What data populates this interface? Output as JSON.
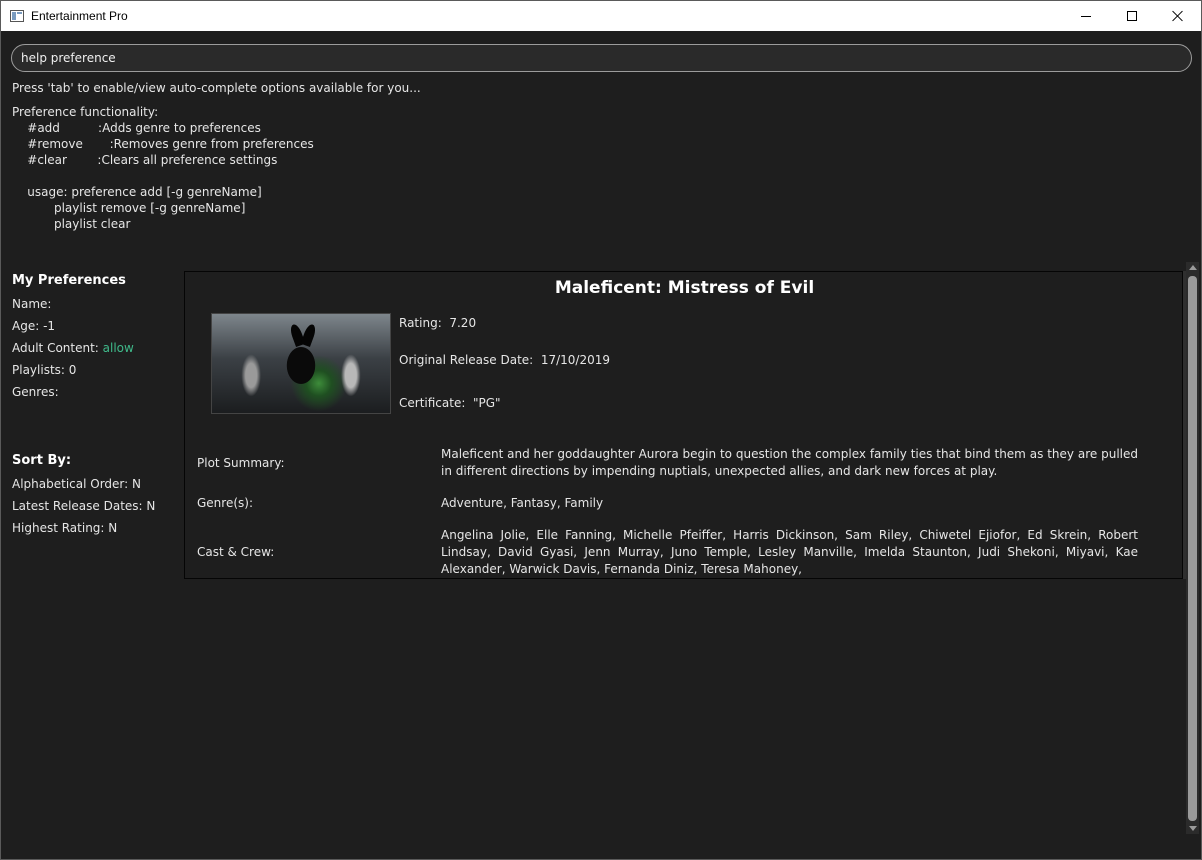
{
  "window": {
    "title": "Entertainment Pro"
  },
  "command": {
    "value": "help preference",
    "hint": "Press 'tab' to enable/view auto-complete options available for you..."
  },
  "help": {
    "lines": [
      "Preference functionality:",
      "    #add          :Adds genre to preferences",
      "    #remove       :Removes genre from preferences",
      "    #clear        :Clears all preference settings",
      "",
      "    usage: preference add [-g genreName]",
      "           playlist remove [-g genreName]",
      "           playlist clear"
    ]
  },
  "preferences": {
    "title": "My Preferences",
    "name_label": "Name:",
    "name_value": "",
    "age_label": "Age: -1",
    "adult_label": "Adult Content: ",
    "adult_value": "allow",
    "playlists_label": "Playlists: 0",
    "genres_label": "Genres:"
  },
  "sort": {
    "title": "Sort By:",
    "alphabetical": "Alphabetical Order: N",
    "latest": "Latest Release Dates: N",
    "rating": "Highest Rating: N"
  },
  "movie": {
    "title": "Maleficent: Mistress of Evil",
    "rating": "Rating:  7.20",
    "release": "Original Release Date:  17/10/2019",
    "certificate": "Certificate:  \"PG\"",
    "plot_label": "Plot Summary:",
    "plot": "Maleficent and her goddaughter Aurora begin to question the complex family ties that bind them as they are pulled in different directions by impending nuptials, unexpected allies, and dark new forces at play.",
    "genre_label": "Genre(s):",
    "genres": "Adventure, Fantasy, Family",
    "cast_label": "Cast & Crew:",
    "cast": "Angelina Jolie, Elle Fanning, Michelle Pfeiffer, Harris Dickinson, Sam Riley, Chiwetel Ejiofor, Ed Skrein, Robert Lindsay, David Gyasi, Jenn Murray, Juno Temple, Lesley Manville, Imelda Staunton, Judi Shekoni, Miyavi, Kae Alexander, Warwick Davis, Fernanda Diniz, Teresa Mahoney,"
  },
  "icons": {
    "app": "app-window-icon",
    "minimize": "minimize-icon",
    "maximize": "maximize-icon",
    "close": "close-icon",
    "poster": "movie-poster-image"
  },
  "colors": {
    "background": "#1e1e1e",
    "accent_allow": "#3fb98a",
    "titlebar": "#ffffff"
  }
}
